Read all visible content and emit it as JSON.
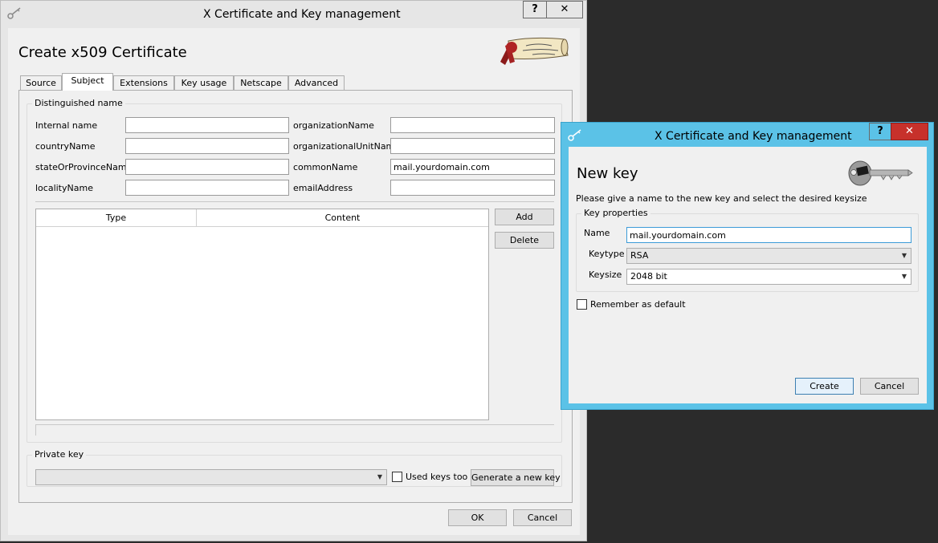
{
  "main_window": {
    "title": "X Certificate and Key management",
    "help_label": "?",
    "close_label": "✕",
    "heading": "Create x509 Certificate",
    "tabs": [
      {
        "label": "Source"
      },
      {
        "label": "Subject"
      },
      {
        "label": "Extensions"
      },
      {
        "label": "Key usage"
      },
      {
        "label": "Netscape"
      },
      {
        "label": "Advanced"
      }
    ],
    "active_tab": "Subject",
    "dn_group_title": "Distinguished name",
    "fields": {
      "internal_name": {
        "label": "Internal name",
        "value": ""
      },
      "country_name": {
        "label": "countryName",
        "value": ""
      },
      "state_name": {
        "label": "stateOrProvinceName",
        "value": ""
      },
      "locality_name": {
        "label": "localityName",
        "value": ""
      },
      "organization_name": {
        "label": "organizationName",
        "value": ""
      },
      "org_unit_name": {
        "label": "organizationalUnitName",
        "value": ""
      },
      "common_name": {
        "label": "commonName",
        "value": "mail.yourdomain.com"
      },
      "email_address": {
        "label": "emailAddress",
        "value": ""
      }
    },
    "table": {
      "headers": [
        "Type",
        "Content"
      ]
    },
    "add_label": "Add",
    "delete_label": "Delete",
    "private_key_group_title": "Private key",
    "private_key_value": "",
    "used_keys_label": "Used keys too",
    "generate_label": "Generate a new key",
    "ok_label": "OK",
    "cancel_label": "Cancel"
  },
  "dialog": {
    "title": "X Certificate and Key management",
    "help_label": "?",
    "close_label": "✕",
    "heading": "New key",
    "description": "Please give a name to the new key and select the desired keysize",
    "group_title": "Key properties",
    "name_label": "Name",
    "name_value": "mail.yourdomain.com",
    "keytype_label": "Keytype",
    "keytype_value": "RSA",
    "keysize_label": "Keysize",
    "keysize_value": "2048 bit",
    "remember_label": "Remember as default",
    "create_label": "Create",
    "cancel_label": "Cancel"
  },
  "colors": {
    "main_frame": "#e6e6e6",
    "dialog_frame": "#5bc2e7",
    "close_button": "#c7312b",
    "desktop": "#2b2b2b"
  }
}
